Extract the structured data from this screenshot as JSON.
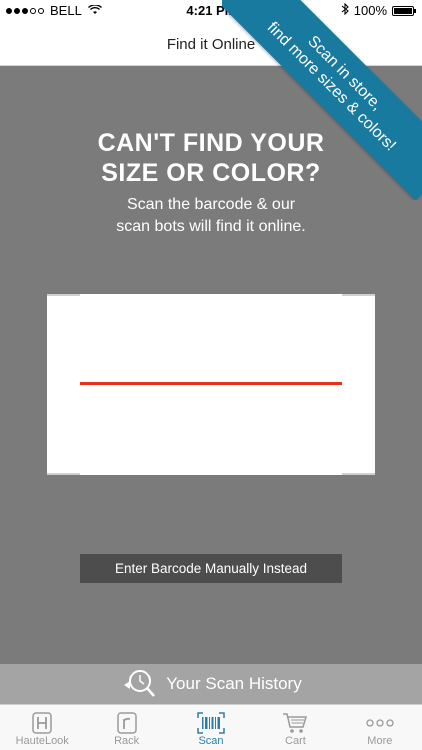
{
  "status_bar": {
    "carrier": "BELL",
    "time": "4:21 PM",
    "battery": "100%"
  },
  "nav": {
    "title": "Find it Online"
  },
  "ribbon": {
    "line1": "Scan in store,",
    "line2": "find more sizes & colors!"
  },
  "main": {
    "headline_line1": "CAN'T FIND YOUR",
    "headline_line2": "SIZE OR COLOR?",
    "subtext_line1": "Scan the barcode & our",
    "subtext_line2": "scan bots will find it online.",
    "manual_button": "Enter Barcode Manually Instead"
  },
  "history": {
    "label": "Your Scan History"
  },
  "tabs": [
    {
      "label": "HauteLook",
      "icon": "hautelook-icon"
    },
    {
      "label": "Rack",
      "icon": "rack-icon"
    },
    {
      "label": "Scan",
      "icon": "barcode-icon"
    },
    {
      "label": "Cart",
      "icon": "cart-icon"
    },
    {
      "label": "More",
      "icon": "more-icon"
    }
  ],
  "colors": {
    "accent": "#197aa0",
    "active_tab": "#2a7fa8",
    "scan_line": "#e0321c",
    "background": "#7b7b7b"
  }
}
